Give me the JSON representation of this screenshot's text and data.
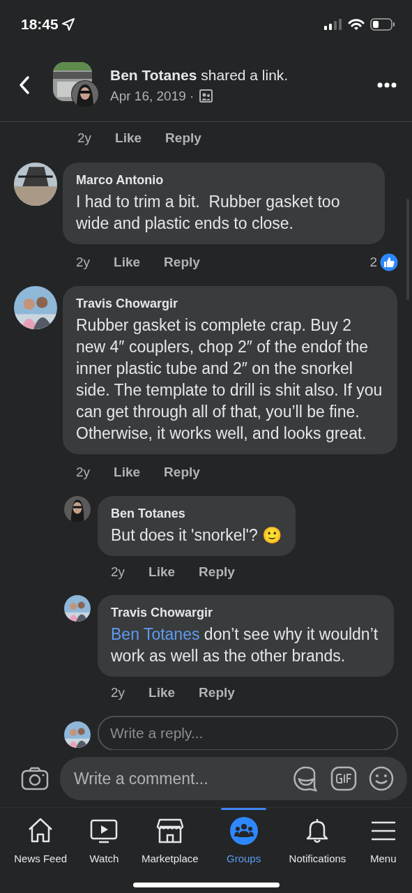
{
  "status_bar": {
    "time": "18:45"
  },
  "header": {
    "author": "Ben Totanes",
    "action": "shared a link.",
    "date": "Apr 16, 2019 ·"
  },
  "top_meta": {
    "time": "2y",
    "like": "Like",
    "reply": "Reply"
  },
  "comments": [
    {
      "author": "Marco Antonio",
      "text": "I had to trim a bit.  Rubber gasket too wide and plastic ends to close.",
      "time": "2y",
      "like": "Like",
      "reply": "Reply",
      "reactions": "2"
    },
    {
      "author": "Travis Chowargir",
      "text": "Rubber gasket is complete crap. Buy 2 new 4″ couplers, chop 2″ of the endof the inner plastic tube and 2″ on the snorkel side. The template to drill is shit also. If you can get through all of that, you’ll be fine. Otherwise, it works well, and looks great.",
      "time": "2y",
      "like": "Like",
      "reply": "Reply",
      "children": [
        {
          "author": "Ben Totanes",
          "text": "But does it 'snorkel'?",
          "emoji": "🙂",
          "time": "2y",
          "like": "Like",
          "reply": "Reply"
        },
        {
          "author": "Travis Chowargir",
          "mention": "Ben Totanes",
          "text": "don’t see why it wouldn’t work as well as the other brands.",
          "time": "2y",
          "like": "Like",
          "reply": "Reply"
        }
      ]
    }
  ],
  "reply_field": {
    "placeholder": "Write a reply..."
  },
  "composer": {
    "placeholder": "Write a comment..."
  },
  "tabs": [
    {
      "label": "News Feed",
      "kind": "home",
      "selected": false
    },
    {
      "label": "Watch",
      "kind": "watch",
      "selected": false
    },
    {
      "label": "Marketplace",
      "kind": "market",
      "selected": false
    },
    {
      "label": "Groups",
      "kind": "groups",
      "selected": true
    },
    {
      "label": "Notifications",
      "kind": "bell",
      "selected": false
    },
    {
      "label": "Menu",
      "kind": "menu",
      "selected": false
    }
  ]
}
